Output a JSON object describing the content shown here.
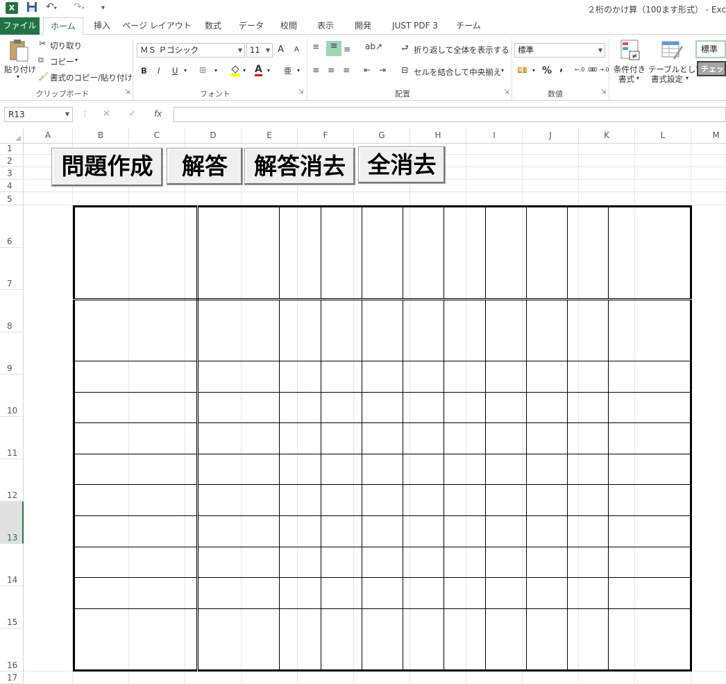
{
  "app": {
    "logo": "X",
    "title": "２桁のかけ算（100ます形式） - Exc"
  },
  "quick_access": {
    "save_icon": "save-icon",
    "undo_icon": "undo-icon",
    "redo_icon": "redo-icon"
  },
  "tabs": [
    "ファイル",
    "ホーム",
    "挿入",
    "ページ レイアウト",
    "数式",
    "データ",
    "校閲",
    "表示",
    "開発",
    "JUST PDF 3",
    "チーム"
  ],
  "ribbon": {
    "clipboard": {
      "paste": "貼り付け",
      "cut": "切り取り",
      "copy": "コピー",
      "format_painter": "書式のコピー/貼り付け",
      "label": "クリップボード"
    },
    "font": {
      "name": "ＭＳ Ｐゴシック",
      "size": "11",
      "bold": "B",
      "italic": "I",
      "underline": "U",
      "grow": "A",
      "shrink": "A",
      "font_color": "A",
      "phonetic": "亜",
      "label": "フォント"
    },
    "alignment": {
      "wrap": "折り返して全体を表示する",
      "merge": "セルを結合して中央揃え",
      "label": "配置"
    },
    "number": {
      "format": "標準",
      "percent": "%",
      "comma": ",",
      "inc": "←.0 .00",
      "dec": ".00 →.0",
      "label": "数値"
    },
    "styles": {
      "conditional": "条件付き",
      "conditional2": "書式",
      "table": "テーブルとして",
      "table2": "書式設定",
      "style_normal": "標準",
      "style_check": "チェッ"
    }
  },
  "formula_bar": {
    "name_box": "R13",
    "cancel": "✕",
    "enter": "✓",
    "fx": "fx",
    "value": ""
  },
  "columns": [
    "A",
    "B",
    "C",
    "D",
    "E",
    "F",
    "G",
    "H",
    "I",
    "J",
    "K",
    "L",
    "M"
  ],
  "rows": [
    "1",
    "2",
    "3",
    "4",
    "5",
    "6",
    "7",
    "8",
    "9",
    "10",
    "11",
    "12",
    "13",
    "14",
    "15",
    "16",
    "17"
  ],
  "selected_row": "13",
  "buttons": {
    "create": "問題作成",
    "answer": "解答",
    "clear_answer": "解答消去",
    "clear_all": "全消去"
  }
}
